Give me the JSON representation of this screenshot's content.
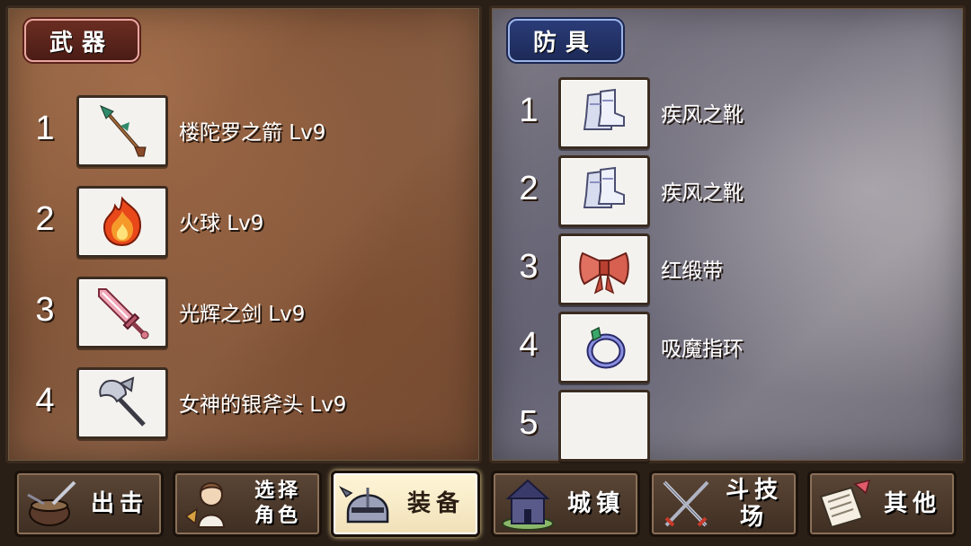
{
  "weapons": {
    "title": "武器",
    "items": [
      {
        "num": "1",
        "name": "楼陀罗之箭 Lv9",
        "icon": "arrow-icon"
      },
      {
        "num": "2",
        "name": "火球 Lv9",
        "icon": "fireball-icon"
      },
      {
        "num": "3",
        "name": "光辉之剑 Lv9",
        "icon": "sword-icon"
      },
      {
        "num": "4",
        "name": "女神的银斧头 Lv9",
        "icon": "axe-icon"
      }
    ]
  },
  "armor": {
    "title": "防具",
    "items": [
      {
        "num": "1",
        "name": "疾风之靴",
        "icon": "boots-icon"
      },
      {
        "num": "2",
        "name": "疾风之靴",
        "icon": "boots-icon"
      },
      {
        "num": "3",
        "name": "红缎带",
        "icon": "ribbon-icon"
      },
      {
        "num": "4",
        "name": "吸魔指环",
        "icon": "ring-icon"
      },
      {
        "num": "5",
        "name": "",
        "icon": "empty-slot"
      }
    ]
  },
  "nav": {
    "sortie": "出击",
    "select_char": "选择\n角色",
    "equip": "装备",
    "town": "城镇",
    "arena": "斗技场",
    "other": "其他",
    "active": "equip"
  },
  "colors": {
    "weapon_title_bg": "#6b2d22",
    "armor_title_bg": "#2a3c78",
    "slot_bg": "#f4f2ee"
  }
}
